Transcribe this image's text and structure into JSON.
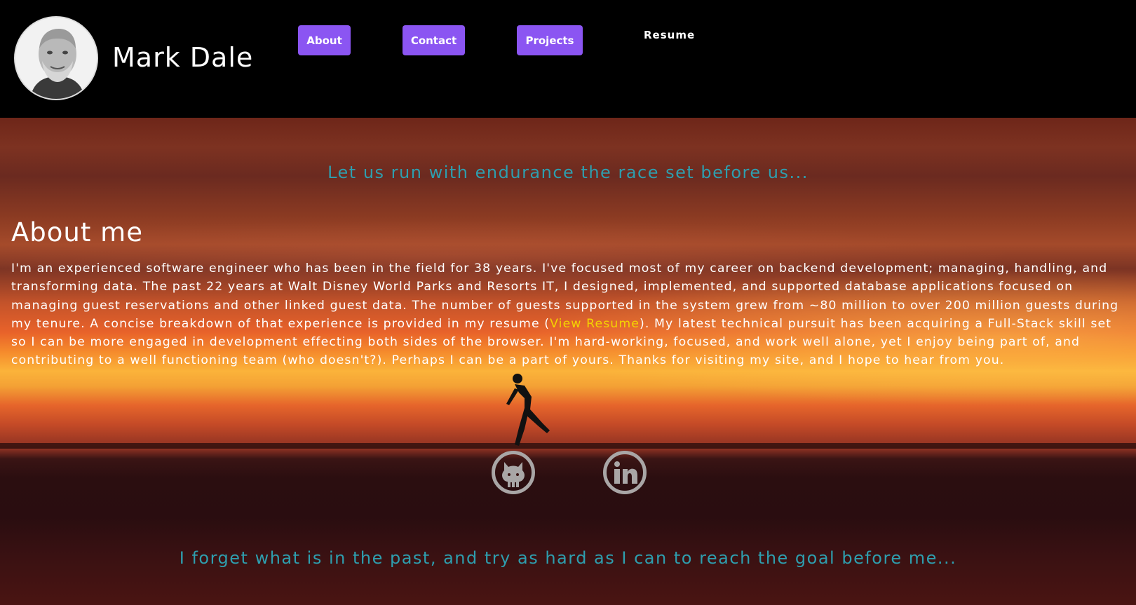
{
  "header": {
    "site_title": "Mark Dale",
    "nav": {
      "about": "About",
      "contact": "Contact",
      "projects": "Projects",
      "resume": "Resume"
    }
  },
  "hero": {
    "quote_top": "Let us run with endurance the race set before us...",
    "about_heading": "About me",
    "about_text_before_link": "I'm an experienced software engineer who has been in the field for 38 years. I've focused most of my career on backend development; managing, handling, and transforming data. The past 22 years at Walt Disney World Parks and Resorts IT, I designed, implemented, and supported database applications focused on managing guest reservations and other linked guest data. The number of guests supported in the system grew from ~80 million to over 200 million guests during my tenure. A concise breakdown of that experience is provided in my resume (",
    "resume_link_label": "View Resume",
    "about_text_after_link": "). My latest technical pursuit has been acquiring a Full-Stack skill set so I can be more engaged in development effecting both sides of the browser. I'm hard-working, focused, and work well alone, yet I enjoy being part of, and contributing to a well functioning team (who doesn't?). Perhaps I can be a part of yours. Thanks for visiting my site, and I hope to hear from you.",
    "quote_bottom": "I forget what is in the past, and try as hard as I can to reach the goal before me..."
  },
  "social": {
    "github_icon": "github-icon",
    "linkedin_icon": "linkedin-icon"
  },
  "colors": {
    "nav_button": "#8b55f2",
    "quote_text": "#2e9eae",
    "link_text": "#f4d400",
    "social_icon": "#a9a6a6"
  }
}
